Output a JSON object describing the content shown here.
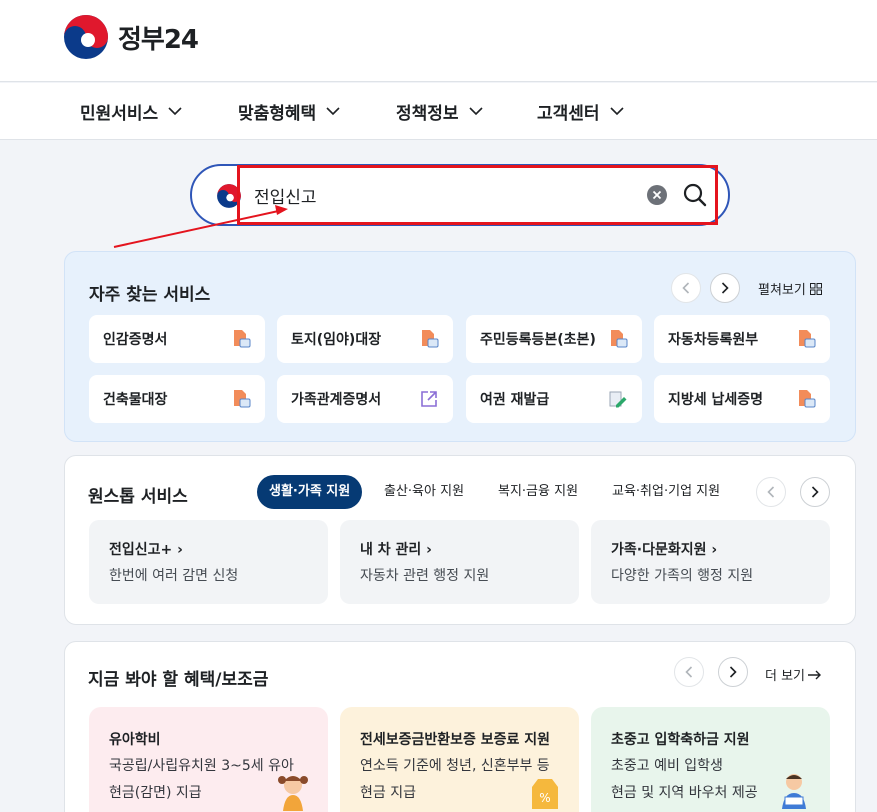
{
  "header": {
    "logo_text": "정부",
    "logo_num": "24"
  },
  "nav": [
    {
      "label": "민원서비스"
    },
    {
      "label": "맞춤형혜택"
    },
    {
      "label": "정책정보"
    },
    {
      "label": "고객센터"
    }
  ],
  "search": {
    "value": "전입신고"
  },
  "frequent": {
    "title": "자주 찾는 서비스",
    "expand_label": "펼쳐보기",
    "items": [
      {
        "label": "인감증명서",
        "icon": "document-pdf-icon"
      },
      {
        "label": "토지(임야)대장",
        "icon": "document-pdf-icon"
      },
      {
        "label": "주민등록등본(초본)",
        "icon": "document-pdf-icon"
      },
      {
        "label": "자동차등록원부",
        "icon": "document-pdf-icon"
      },
      {
        "label": "건축물대장",
        "icon": "document-pdf-icon"
      },
      {
        "label": "가족관계증명서",
        "icon": "external-link-icon"
      },
      {
        "label": "여권 재발급",
        "icon": "edit-document-icon"
      },
      {
        "label": "지방세 납세증명",
        "icon": "document-pdf-icon"
      }
    ]
  },
  "onestop": {
    "title": "원스톱 서비스",
    "tabs": [
      {
        "label": "생활·가족 지원",
        "active": true
      },
      {
        "label": "출산·육아 지원"
      },
      {
        "label": "복지·금융 지원"
      },
      {
        "label": "교육·취업·기업 지원"
      }
    ],
    "cards": [
      {
        "title": "전입신고+",
        "desc": "한번에 여러 감면 신청"
      },
      {
        "title": "내 차 관리",
        "desc": "자동차 관련 행정 지원"
      },
      {
        "title": "가족·다문화지원",
        "desc": "다양한 가족의 행정 지원"
      }
    ]
  },
  "benefits": {
    "title": "지금 봐야 할 혜택/보조금",
    "more_label": "더 보기",
    "cards": [
      {
        "title": "유아학비",
        "line1": "국공립/사립유치원 3~5세 유아",
        "line2": "현금(감면) 지급",
        "bg": "#fdecef"
      },
      {
        "title": "전세보증금반환보증 보증료 지원",
        "line1": "연소득 기준에 청년, 신혼부부 등",
        "line2": "현금 지급",
        "bg": "#fdf2dc"
      },
      {
        "title": "초중고 입학축하금 지원",
        "line1": "초중고 예비 입학생",
        "line2": "현금 및 지역 바우처 제공",
        "bg": "#e8f5ec"
      }
    ]
  },
  "colors": {
    "primary": "#063a74",
    "accent_border": "#2f56b8",
    "annotation": "#e4141e"
  }
}
